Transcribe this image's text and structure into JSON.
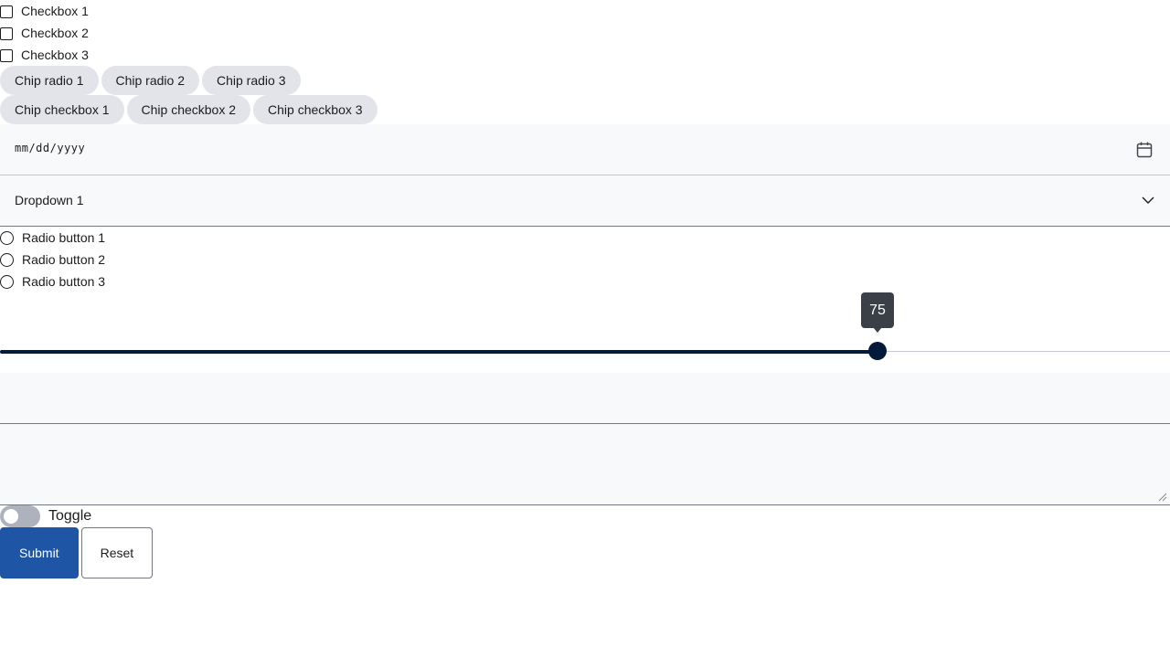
{
  "checkboxes": [
    {
      "label": "Checkbox 1",
      "checked": false
    },
    {
      "label": "Checkbox 2",
      "checked": false
    },
    {
      "label": "Checkbox 3",
      "checked": false
    }
  ],
  "chip_radios": [
    {
      "label": "Chip radio 1"
    },
    {
      "label": "Chip radio 2"
    },
    {
      "label": "Chip radio 3"
    }
  ],
  "chip_checkboxes": [
    {
      "label": "Chip checkbox 1"
    },
    {
      "label": "Chip checkbox 2"
    },
    {
      "label": "Chip checkbox 3"
    }
  ],
  "date_input": {
    "placeholder": "mm/dd/yyyy",
    "icon": "calendar-icon"
  },
  "dropdown": {
    "value": "Dropdown 1",
    "icon": "chevron-down-icon"
  },
  "radio_buttons": [
    {
      "label": "Radio button 1",
      "selected": false
    },
    {
      "label": "Radio button 2",
      "selected": false
    },
    {
      "label": "Radio button 3",
      "selected": false
    }
  ],
  "slider": {
    "value": "75",
    "fraction": 0.75
  },
  "text_input": {
    "value": ""
  },
  "textarea": {
    "value": ""
  },
  "toggle": {
    "label": "Toggle",
    "on": false
  },
  "buttons": {
    "submit_label": "Submit",
    "reset_label": "Reset"
  },
  "colors": {
    "primary": "#1f55a5",
    "slider": "#041a3b",
    "chip_bg": "#e3e4ea",
    "field_bg": "#f8f9fb"
  }
}
